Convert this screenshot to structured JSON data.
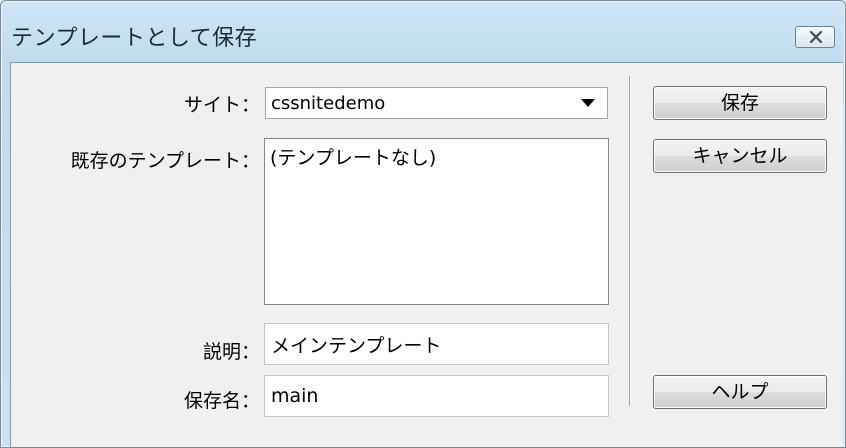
{
  "window": {
    "title": "テンプレートとして保存"
  },
  "form": {
    "site_label": "サイト：",
    "site_value": "cssnitedemo",
    "existing_label": "既存のテンプレート：",
    "existing_items": [
      "(テンプレートなし)"
    ],
    "description_label": "説明：",
    "description_value": "メインテンプレート",
    "save_name_label": "保存名：",
    "save_name_value": "main"
  },
  "buttons": {
    "save": "保存",
    "cancel": "キャンセル",
    "help": "ヘルプ"
  }
}
